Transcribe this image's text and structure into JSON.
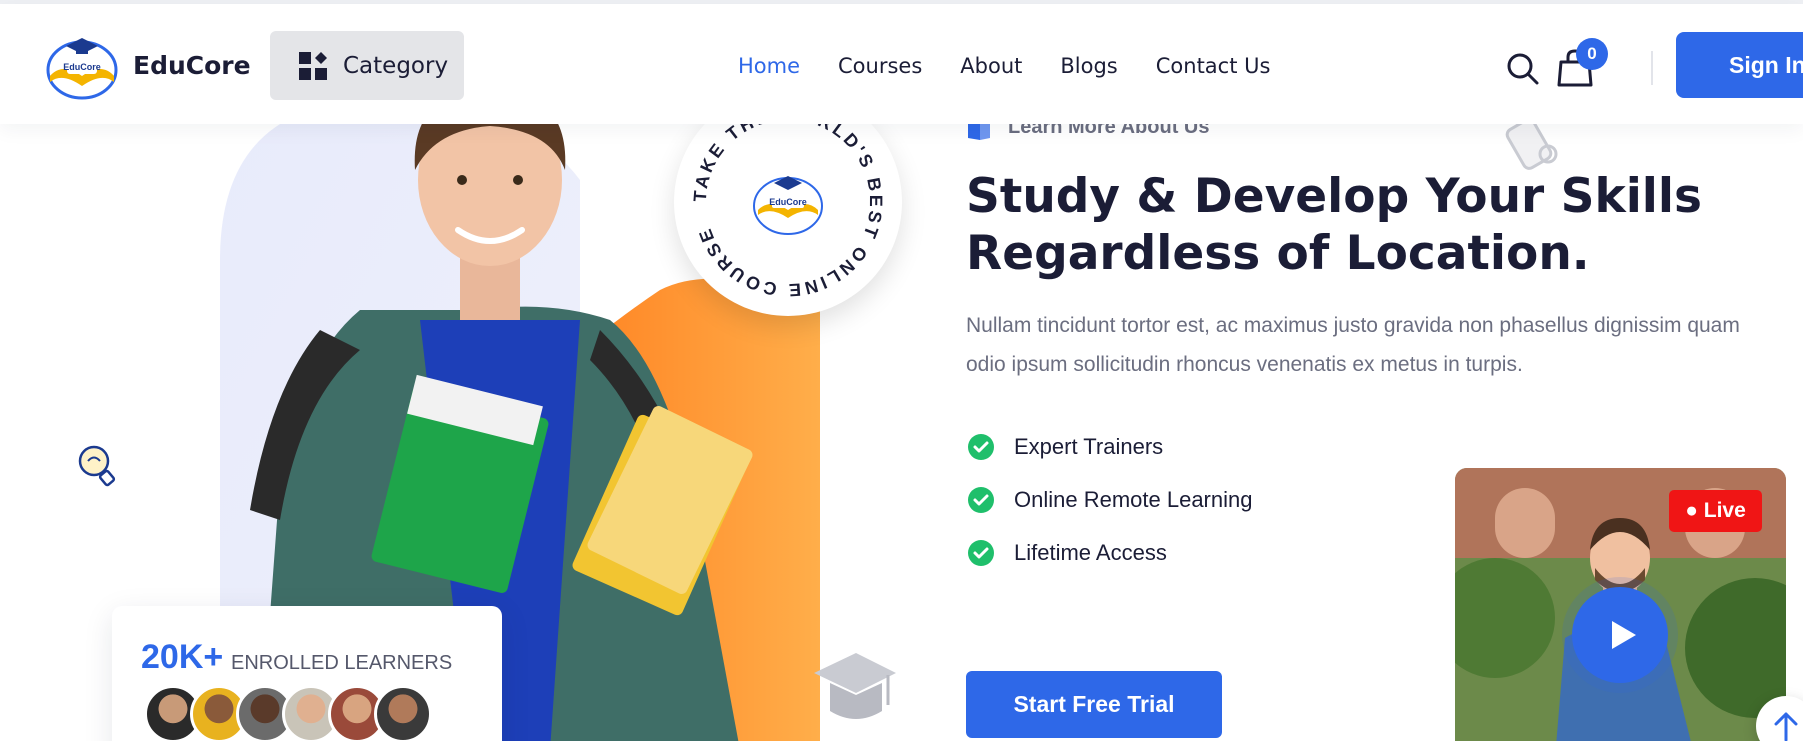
{
  "header": {
    "brand": "EduCore",
    "logo_text": "EduCore",
    "category_label": "Category",
    "nav": [
      {
        "label": "Home",
        "active": true
      },
      {
        "label": "Courses",
        "active": false
      },
      {
        "label": "About",
        "active": false
      },
      {
        "label": "Blogs",
        "active": false
      },
      {
        "label": "Contact Us",
        "active": false
      }
    ],
    "cart_count": "0",
    "signin_label": "Sign In"
  },
  "hero": {
    "eyebrow": "Learn More About Us",
    "headline_line1": "Study & Develop Your Skills",
    "headline_line2": "Regardless of Location.",
    "description": "Nullam tincidunt tortor est, ac maximus justo gravida non phasellus dignissim quam odio ipsum sollicitudin rhoncus venenatis ex metus in turpis.",
    "features": [
      "Expert Trainers",
      "Online Remote Learning",
      "Lifetime Access"
    ],
    "cta_label": "Start Free Trial",
    "badge_ring_text": "TAKE THE WORLD'S BEST ONLINE COURSE",
    "learners_count": "20K+",
    "learners_label": "ENROLLED LEARNERS",
    "live_label": "Live"
  },
  "icons": [
    "category-grid-icon",
    "search-icon",
    "shopping-bag-icon",
    "lightbulb-icon",
    "check-circle-icon",
    "play-icon",
    "arrow-up-icon",
    "graduation-cap-icon",
    "scroll-icon",
    "book-icon"
  ],
  "colors": {
    "accent": "#2e68e8",
    "heading": "#1b1d36",
    "muted": "#6b6e80",
    "check": "#1fbf6b",
    "live": "#f01515",
    "orange": "#ff9a3c"
  }
}
